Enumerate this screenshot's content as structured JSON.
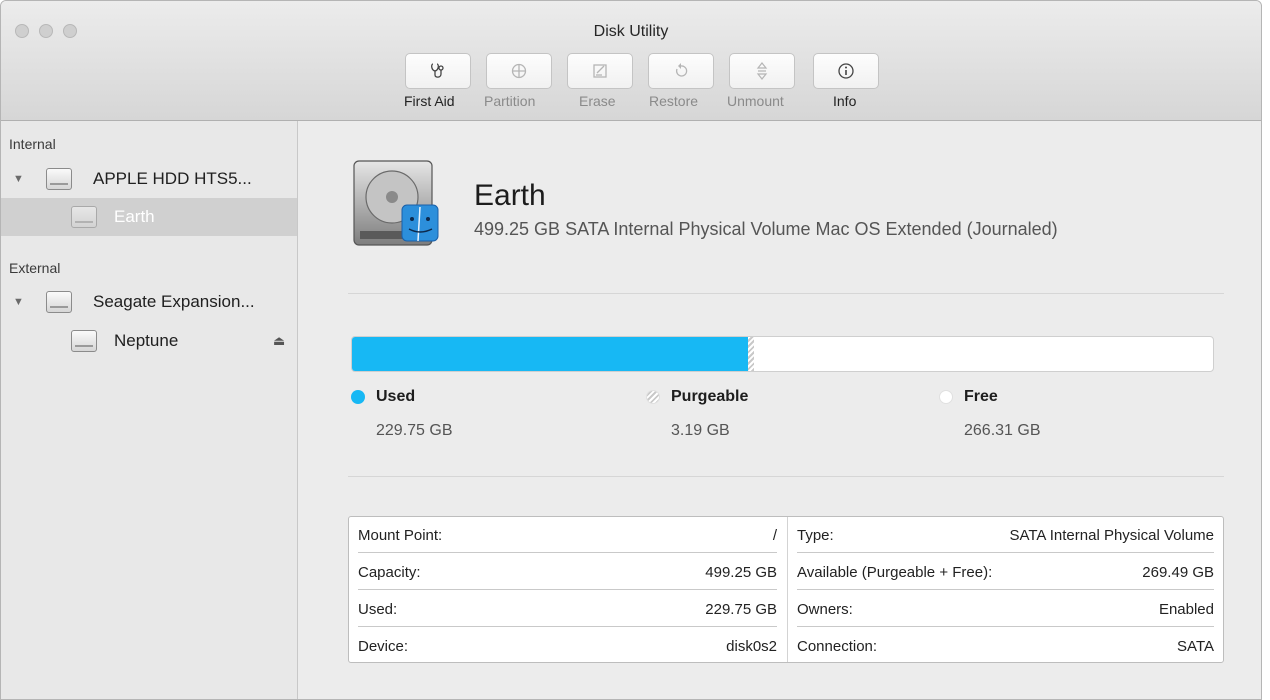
{
  "window": {
    "title": "Disk Utility"
  },
  "toolbar": {
    "buttons": [
      {
        "label": "First Aid",
        "icon": "stethoscope-icon",
        "enabled": true
      },
      {
        "label": "Partition",
        "icon": "partition-icon",
        "enabled": false
      },
      {
        "label": "Erase",
        "icon": "erase-icon",
        "enabled": false
      },
      {
        "label": "Restore",
        "icon": "restore-icon",
        "enabled": false
      },
      {
        "label": "Unmount",
        "icon": "unmount-icon",
        "enabled": false
      },
      {
        "label": "Info",
        "icon": "info-icon",
        "enabled": true
      }
    ]
  },
  "sidebar": {
    "internal_label": "Internal",
    "external_label": "External",
    "internal_disk": "APPLE HDD HTS5...",
    "internal_volume": "Earth",
    "external_disk": "Seagate Expansion...",
    "external_volume": "Neptune"
  },
  "volume": {
    "name": "Earth",
    "description": "499.25 GB SATA Internal Physical Volume Mac OS Extended (Journaled)"
  },
  "usage": {
    "used_fraction": 0.4602,
    "purgeable_fraction": 0.0064,
    "colors": {
      "used": "#17b8f4",
      "free": "#ffffff"
    },
    "used_label": "Used",
    "used_value": "229.75 GB",
    "purgeable_label": "Purgeable",
    "purgeable_value": "3.19 GB",
    "free_label": "Free",
    "free_value": "266.31 GB"
  },
  "info": {
    "left": [
      {
        "key": "Mount Point:",
        "value": "/"
      },
      {
        "key": "Capacity:",
        "value": "499.25 GB"
      },
      {
        "key": "Used:",
        "value": "229.75 GB"
      },
      {
        "key": "Device:",
        "value": "disk0s2"
      }
    ],
    "right": [
      {
        "key": "Type:",
        "value": "SATA Internal Physical Volume"
      },
      {
        "key": "Available (Purgeable + Free):",
        "value": "269.49 GB"
      },
      {
        "key": "Owners:",
        "value": "Enabled"
      },
      {
        "key": "Connection:",
        "value": "SATA"
      }
    ]
  }
}
